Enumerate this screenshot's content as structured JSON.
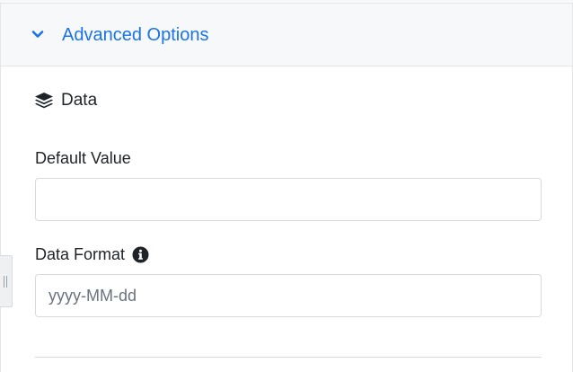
{
  "colors": {
    "accent": "#1a73e8",
    "text": "#1f2328",
    "border": "#d7dbe0",
    "header_bg": "#f7f8f9"
  },
  "accordion": {
    "title": "Advanced Options",
    "expanded": true,
    "icon": "chevron-down-icon"
  },
  "data_section": {
    "title": "Data",
    "icon": "layers-icon"
  },
  "fields": {
    "default_value": {
      "label": "Default Value",
      "value": "",
      "placeholder": ""
    },
    "data_format": {
      "label": "Data Format",
      "value": "",
      "placeholder": "yyyy-MM-dd",
      "icon": "info-icon"
    }
  }
}
